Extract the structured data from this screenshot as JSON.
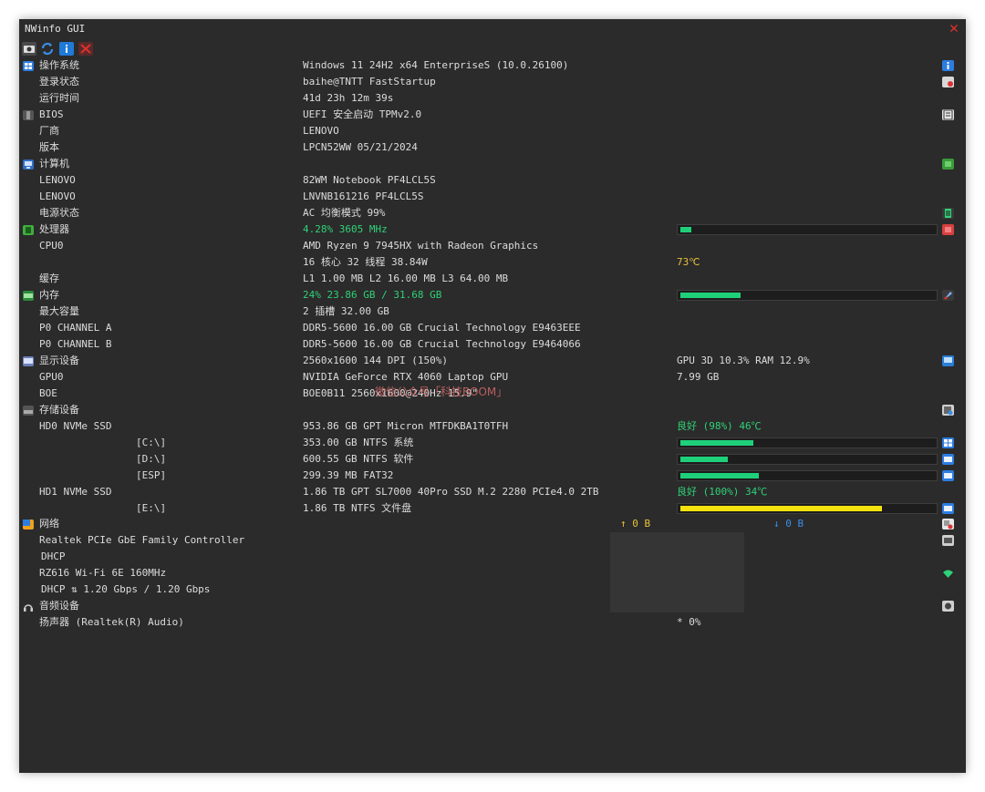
{
  "window": {
    "title": "NWinfo GUI"
  },
  "watermark": "微信公众号「科技BOOM」",
  "toolbar": {
    "icons": [
      "camera-icon",
      "refresh-icon",
      "info-icon",
      "close-icon"
    ]
  },
  "rows": {
    "os": {
      "label": "操作系统",
      "value": "Windows 11 24H2 x64 EnterpriseS (10.0.26100)"
    },
    "login": {
      "label": "登录状态",
      "value": "baihe@TNTT FastStartup"
    },
    "uptime": {
      "label": "运行时间",
      "value": "41d 23h 12m 39s"
    },
    "bios": {
      "label": "BIOS",
      "value": "UEFI 安全启动 TPMv2.0"
    },
    "vendor": {
      "label": "厂商",
      "value": "LENOVO"
    },
    "version": {
      "label": "版本",
      "value": "LPCN52WW 05/21/2024"
    },
    "computer": {
      "label": "计算机",
      "value": ""
    },
    "lenovo1": {
      "label": "LENOVO",
      "value": "82WM Notebook PF4LCL5S"
    },
    "lenovo2": {
      "label": "LENOVO",
      "value": "LNVNB161216 PF4LCL5S"
    },
    "power": {
      "label": "电源状态",
      "value": "AC  均衡模式 99%"
    },
    "cpu": {
      "label": "处理器",
      "value": "4.28% 3605 MHz",
      "usage": 4.28
    },
    "cpu0": {
      "label": "CPU0",
      "value": "AMD Ryzen 9 7945HX with Radeon Graphics"
    },
    "cores": {
      "label": "",
      "value": "16 核心 32 线程 38.84W",
      "extra": "73℃"
    },
    "cache": {
      "label": "缓存",
      "value": "L1 1.00 MB L2 16.00 MB L3 64.00 MB"
    },
    "memory": {
      "label": "内存",
      "value": "24% 23.86 GB / 31.68 GB",
      "usage": 24
    },
    "maxcap": {
      "label": "最大容量",
      "value": "2 插槽 32.00 GB"
    },
    "chanA": {
      "label": "P0 CHANNEL A",
      "value": "DDR5-5600 16.00 GB Crucial Technology E9463EEE"
    },
    "chanB": {
      "label": "P0 CHANNEL B",
      "value": "DDR5-5600 16.00 GB Crucial Technology E9464066"
    },
    "display": {
      "label": "显示设备",
      "value": "2560x1600 144 DPI (150%)",
      "extra": "GPU 3D 10.3% RAM 12.9%"
    },
    "gpu0": {
      "label": "GPU0",
      "value": "NVIDIA GeForce RTX 4060 Laptop GPU",
      "extra": "7.99 GB"
    },
    "boe": {
      "label": "BOE",
      "value": "BOE0B11 2560x1600@240Hz 15.9\""
    },
    "storage": {
      "label": "存储设备",
      "value": ""
    },
    "hd0": {
      "label": "HD0 NVMe SSD",
      "value": "953.86 GB GPT Micron MTFDKBA1T0TFH",
      "extra": "良好 (98%) 46℃"
    },
    "c": {
      "label": "[C:\\]",
      "value": "353.00 GB NTFS 系统",
      "usage": 29
    },
    "d": {
      "label": "[D:\\]",
      "value": "600.55 GB NTFS 软件",
      "usage": 19
    },
    "esp": {
      "label": "[ESP]",
      "value": "299.39 MB FAT32",
      "usage": 31
    },
    "hd1": {
      "label": "HD1 NVMe SSD",
      "value": "1.86 TB GPT SL7000 40Pro SSD M.2 2280 PCIe4.0 2TB",
      "extra": "良好 (100%) 34℃"
    },
    "e": {
      "label": "[E:\\]",
      "value": "1.86 TB NTFS 文件盘",
      "usage": 80
    },
    "network": {
      "label": "网络",
      "value": "",
      "up": "↑ 0 B",
      "down": "↓ 0 B"
    },
    "realtek": {
      "label": "Realtek PCIe GbE Family Controller",
      "value": ""
    },
    "dhcp1": {
      "label": "DHCP",
      "value": ""
    },
    "wifi": {
      "label": "RZ616 Wi-Fi 6E 160MHz",
      "value": ""
    },
    "dhcp2": {
      "label": "DHCP ⇅ 1.20 Gbps / 1.20 Gbps",
      "value": ""
    },
    "audio": {
      "label": "音频设备",
      "value": ""
    },
    "speaker": {
      "label": "扬声器 (Realtek(R) Audio)",
      "value": "",
      "extra": "* 0%"
    }
  },
  "colors": {
    "accent_green": "#2fd176",
    "temp_yellow": "#e7c23b",
    "bar_green": "#1fd07a",
    "bar_yellow": "#f3e20d",
    "close_red": "#e0302b"
  }
}
